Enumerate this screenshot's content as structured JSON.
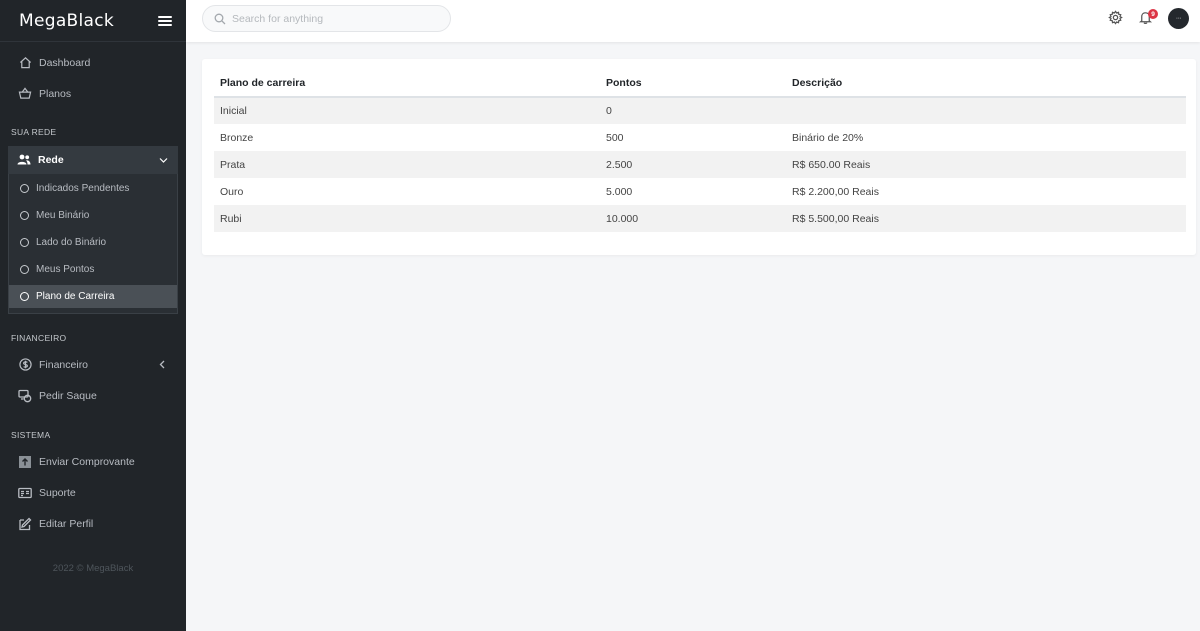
{
  "app": {
    "brand": "MegaBlack",
    "footer": "2022 © MegaBlack"
  },
  "sidebar": {
    "top_items": [
      {
        "label": "Dashboard",
        "icon": "home-icon"
      },
      {
        "label": "Planos",
        "icon": "basket-icon"
      }
    ],
    "sections": {
      "sua_rede": "SUA REDE",
      "financeiro": "FINANCEIRO",
      "sistema": "SISTEMA"
    },
    "rede": {
      "label": "Rede",
      "icon": "users-icon",
      "submenu": [
        {
          "label": "Indicados Pendentes"
        },
        {
          "label": "Meu Binário"
        },
        {
          "label": "Lado do Binário"
        },
        {
          "label": "Meus Pontos"
        },
        {
          "label": "Plano de Carreira",
          "active": true
        }
      ]
    },
    "financeiro_items": [
      {
        "label": "Financeiro",
        "icon": "dollar-circle-icon"
      },
      {
        "label": "Pedir Saque",
        "icon": "cash-icon"
      }
    ],
    "sistema_items": [
      {
        "label": "Enviar Comprovante",
        "icon": "upload-icon"
      },
      {
        "label": "Suporte",
        "icon": "id-card-icon"
      },
      {
        "label": "Editar Perfil",
        "icon": "edit-icon"
      }
    ]
  },
  "topbar": {
    "search_placeholder": "Search for anything",
    "notification_count": "9",
    "avatar_text": "···"
  },
  "table": {
    "headers": [
      "Plano de carreira",
      "Pontos",
      "Descrição"
    ],
    "rows": [
      [
        "Inicial",
        "0",
        ""
      ],
      [
        "Bronze",
        "500",
        "Binário de 20%"
      ],
      [
        "Prata",
        "2.500",
        "R$ 650.00 Reais"
      ],
      [
        "Ouro",
        "5.000",
        "R$ 2.200,00 Reais"
      ],
      [
        "Rubi",
        "10.000",
        "R$ 5.500,00 Reais"
      ]
    ]
  }
}
